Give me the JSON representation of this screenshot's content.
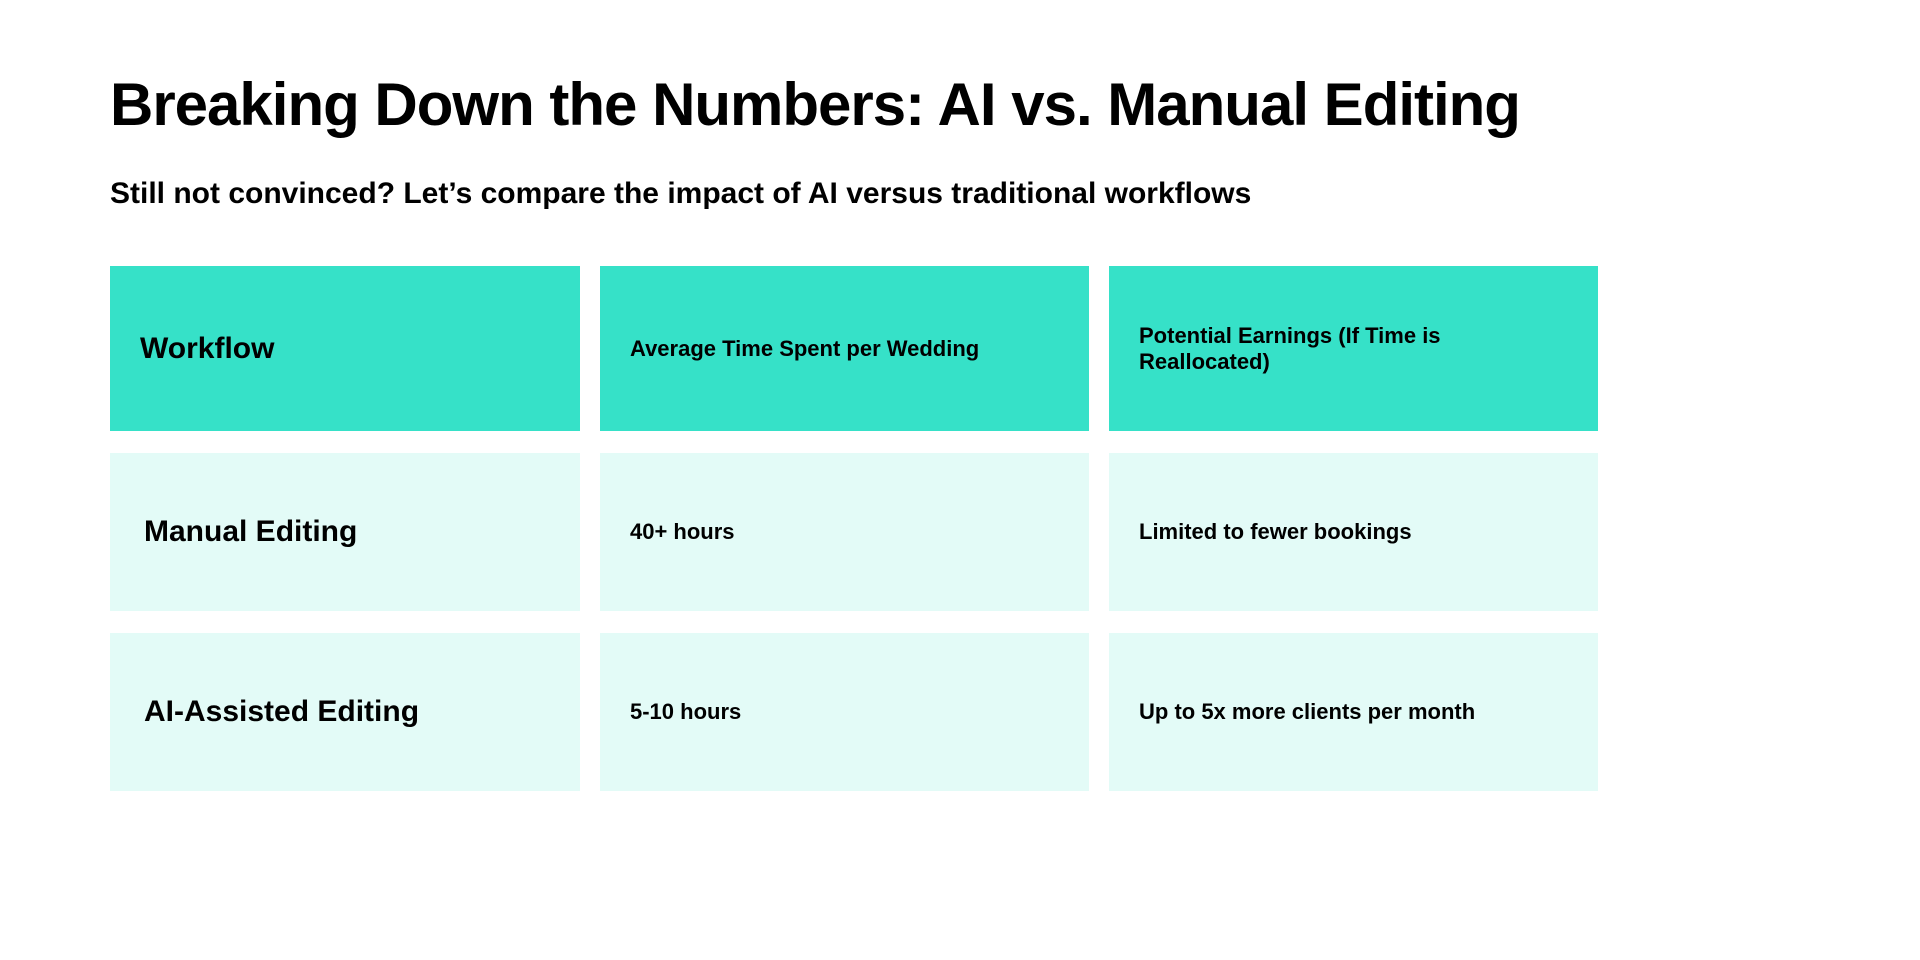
{
  "title": "Breaking Down the Numbers: AI vs. Manual Editing",
  "subtitle": "Still not convinced? Let’s compare the impact of AI versus traditional workflows",
  "chart_data": {
    "type": "table",
    "columns": [
      "Workflow",
      "Average Time Spent per Wedding",
      "Potential Earnings (If Time is Reallocated)"
    ],
    "rows": [
      {
        "workflow": "Manual Editing",
        "time": "40+ hours",
        "earnings": "Limited to fewer bookings"
      },
      {
        "workflow": "AI-Assisted Editing",
        "time": "5-10 hours",
        "earnings": "Up to 5x more clients per month"
      }
    ]
  },
  "colors": {
    "header_bg": "#36e1c8",
    "body_bg": "#e3fbf7"
  }
}
